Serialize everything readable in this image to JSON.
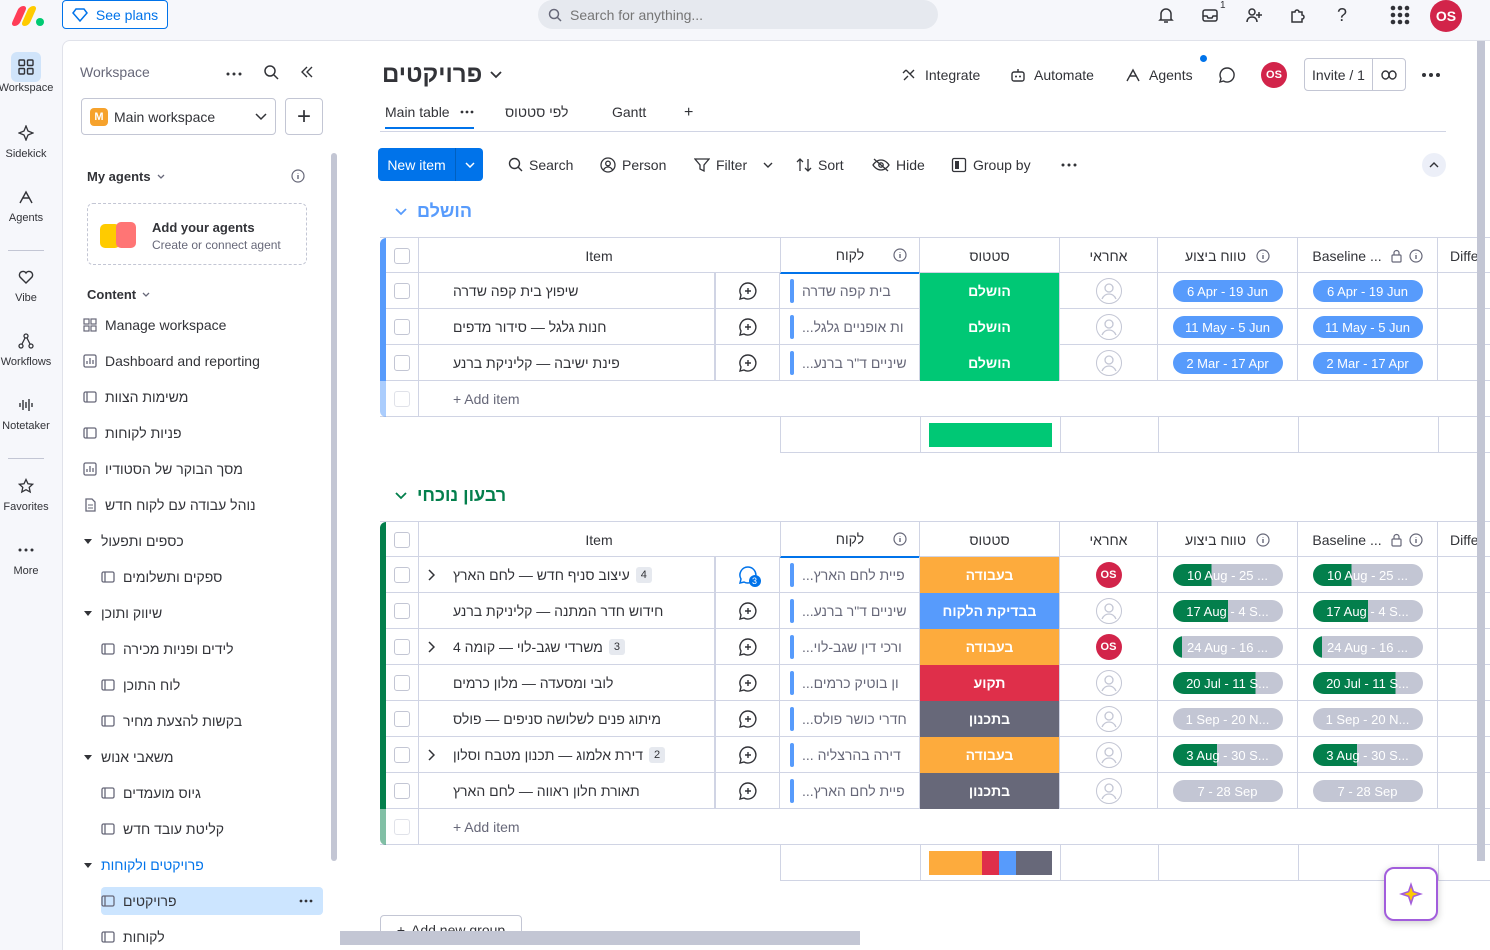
{
  "topbar": {
    "see_plans": "See plans",
    "search_placeholder": "Search for anything...",
    "inbox_count": "1",
    "avatar": "OS",
    "logo_colors": [
      "#ff3d57",
      "#ffcb00",
      "#00ca72"
    ]
  },
  "leftnav": {
    "items": [
      {
        "label": "Workspace",
        "icon": "grid-icon"
      },
      {
        "label": "Sidekick",
        "icon": "sparkle-icon"
      },
      {
        "label": "Agents",
        "icon": "agent-icon"
      },
      {
        "label": "Vibe",
        "icon": "heart-icon"
      },
      {
        "label": "Workflows",
        "icon": "workflow-icon"
      },
      {
        "label": "Notetaker",
        "icon": "waveform-icon"
      },
      {
        "label": "Favorites",
        "icon": "star-icon"
      },
      {
        "label": "More",
        "icon": "more-icon"
      }
    ]
  },
  "sidebar": {
    "title": "Workspace",
    "workspace_name": "Main workspace",
    "workspace_initial": "M",
    "my_agents": "My agents",
    "add_agents_title": "Add your agents",
    "add_agents_sub": "Create or connect agent",
    "content": "Content",
    "items": [
      {
        "label": "Manage workspace",
        "indent": 0
      },
      {
        "label": "Dashboard and reporting",
        "indent": 0
      },
      {
        "label": "משימות הצוות",
        "indent": 0
      },
      {
        "label": "פניות לקוחות",
        "indent": 0
      },
      {
        "label": "מסך הבוקר של הסטודיו",
        "indent": 0
      },
      {
        "label": "נוהל עבודה עם לקוח חדש",
        "indent": 0
      },
      {
        "label": "כספים ותפעול",
        "indent": 0,
        "folder": true
      },
      {
        "label": "ספקים ותשלומים",
        "indent": 1
      },
      {
        "label": "שיווק ותוכן",
        "indent": 0,
        "folder": true
      },
      {
        "label": "לידים ופניות מכירה",
        "indent": 1
      },
      {
        "label": "לוח התוכן",
        "indent": 1
      },
      {
        "label": "בקשות להצעת מחיר",
        "indent": 1
      },
      {
        "label": "משאבי אנוש",
        "indent": 0,
        "folder": true
      },
      {
        "label": "גיוס מועמדים",
        "indent": 1
      },
      {
        "label": "קליטת עובד חדש",
        "indent": 1
      },
      {
        "label": "פרויקטים ולקוחות",
        "indent": 0,
        "folder": true,
        "blue": true
      },
      {
        "label": "פרויקטים",
        "indent": 1,
        "active": true
      },
      {
        "label": "לקוחות",
        "indent": 1
      }
    ]
  },
  "board": {
    "title": "פרויקטים",
    "integrate": "Integrate",
    "automate": "Automate",
    "agents": "Agents",
    "avatar": "OS",
    "invite": "Invite / 1",
    "tabs": [
      "Main table",
      "לפי סטטוס",
      "Gantt",
      "+"
    ],
    "toolbar": {
      "new_item": "New item",
      "search": "Search",
      "person": "Person",
      "filter": "Filter",
      "sort": "Sort",
      "hide": "Hide",
      "group_by": "Group by"
    },
    "columns": {
      "item": "Item",
      "client": "לקוח",
      "status": "סטטוס",
      "owner": "אחראי",
      "timeline": "טווח ביצוע",
      "baseline": "Baseline ...",
      "diff": "Diffe"
    },
    "add_item": "+ Add item",
    "add_group": "Add new group"
  },
  "groups": [
    {
      "name": "הושלם",
      "color": "#579bfc",
      "rows": [
        {
          "name": "שיפוץ בית קפה שדרה",
          "client": "בית קפה שדרה",
          "status": "הושלם",
          "status_color": "#00c875",
          "owner": "",
          "timeline": "6 Apr - 19 Jun",
          "timeline_style": "blue",
          "baseline": "6 Apr - 19 Jun",
          "subitems": "",
          "comments": ""
        },
        {
          "name": "חנות גלגל — סידור מדפים",
          "client": "...ות אופניים גלגל",
          "status": "הושלם",
          "status_color": "#00c875",
          "owner": "",
          "timeline": "11 May - 5 Jun",
          "timeline_style": "blue",
          "baseline": "11 May - 5 Jun",
          "subitems": "",
          "comments": ""
        },
        {
          "name": "פינת ישיבה — קליניקת ברנע",
          "client": "...שיניים ד\"ר ברנע",
          "status": "הושלם",
          "status_color": "#00c875",
          "owner": "",
          "timeline": "2 Mar - 17 Apr",
          "timeline_style": "blue",
          "baseline": "2 Mar - 17 Apr",
          "subitems": "",
          "comments": ""
        }
      ],
      "summary": [
        {
          "color": "#00c875",
          "fraction": 1
        }
      ]
    },
    {
      "name": "רבעון נוכחי",
      "color": "#037f4c",
      "rows": [
        {
          "name": "עיצוב סניף חדש — לחם הארץ",
          "client": "...פיית לחם הארץ",
          "status": "בעבודה",
          "status_color": "#fdab3d",
          "owner": "OS",
          "timeline": "10 Aug - 25 ...",
          "timeline_style": "green",
          "progress": 0.35,
          "baseline": "10 Aug - 25 ...",
          "subitems": "4",
          "comments": "3",
          "expand": true
        },
        {
          "name": "חידוש חדר המתנה — קליניקת ברנע",
          "client": "...שיניים ד\"ר ברנע",
          "status": "בבדיקת הלקוח",
          "status_color": "#579bfc",
          "owner": "",
          "timeline": "17 Aug - 4 S...",
          "timeline_style": "green",
          "progress": 0.5,
          "baseline": "17 Aug - 4 S...",
          "subitems": "",
          "comments": ""
        },
        {
          "name": "משרדי שגב-לוי — קומה 4",
          "client": "...ורכי דין שגב-לוי",
          "status": "בעבודה",
          "status_color": "#fdab3d",
          "owner": "OS",
          "timeline": "24 Aug - 16 ...",
          "timeline_style": "green",
          "progress": 0.08,
          "baseline": "24 Aug - 16 ...",
          "subitems": "3",
          "comments": "",
          "expand": true
        },
        {
          "name": "לובי ומסעדה — מלון כרמים",
          "client": "...ון בוטיק כרמים",
          "status": "תקוע",
          "status_color": "#df2f4a",
          "owner": "",
          "timeline": "20 Jul - 11 S...",
          "timeline_style": "green",
          "progress": 0.75,
          "baseline": "20 Jul - 11 S...",
          "subitems": "",
          "comments": ""
        },
        {
          "name": "מיתוג פנים לשלושה סניפים — פולס",
          "client": "...חדרי כושר פולס",
          "status": "בתכנון",
          "status_color": "#676879",
          "owner": "",
          "timeline": "1 Sep - 20 N...",
          "timeline_style": "grey",
          "progress": 0,
          "baseline": "1 Sep - 20 N...",
          "subitems": "",
          "comments": ""
        },
        {
          "name": "דירת אלמוג — תכנון מטבח וסלון",
          "client": "... דירה בהרצליה",
          "status": "בעבודה",
          "status_color": "#fdab3d",
          "owner": "",
          "timeline": "3 Aug - 30 S...",
          "timeline_style": "green",
          "progress": 0.4,
          "baseline": "3 Aug - 30 S...",
          "subitems": "2",
          "comments": "",
          "expand": true
        },
        {
          "name": "תאורת חלון ראווה — לחם הארץ",
          "client": "...פיית לחם הארץ",
          "status": "בתכנון",
          "status_color": "#676879",
          "owner": "",
          "timeline": "7 - 28 Sep",
          "timeline_style": "grey",
          "progress": 0,
          "baseline": "7 - 28 Sep",
          "subitems": "",
          "comments": ""
        }
      ],
      "summary": [
        {
          "color": "#fdab3d",
          "fraction": 0.43
        },
        {
          "color": "#df2f4a",
          "fraction": 0.14
        },
        {
          "color": "#579bfc",
          "fraction": 0.14
        },
        {
          "color": "#676879",
          "fraction": 0.29
        }
      ]
    }
  ]
}
